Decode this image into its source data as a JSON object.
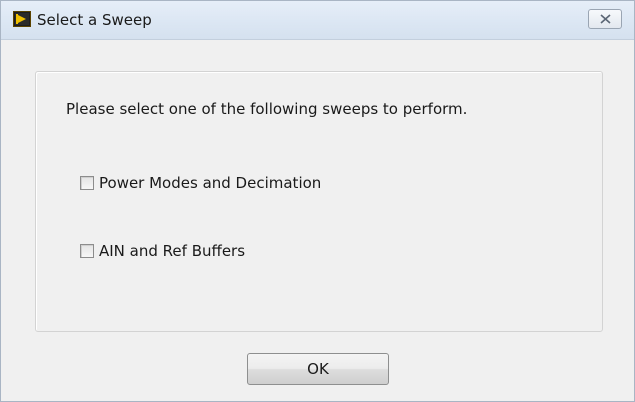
{
  "window": {
    "title": "Select a Sweep",
    "app_icon": "labview-run-icon",
    "close_icon": "close-icon"
  },
  "dialog": {
    "instruction": "Please select one of the following sweeps to perform.",
    "options": [
      {
        "label": "Power Modes and Decimation",
        "checked": false
      },
      {
        "label": "AIN and Ref Buffers",
        "checked": false
      }
    ],
    "ok_label": "OK"
  },
  "colors": {
    "titlebar": "#dbe6f3",
    "dialog_background": "#f0f0f0",
    "icon_accent": "#f0c000"
  }
}
